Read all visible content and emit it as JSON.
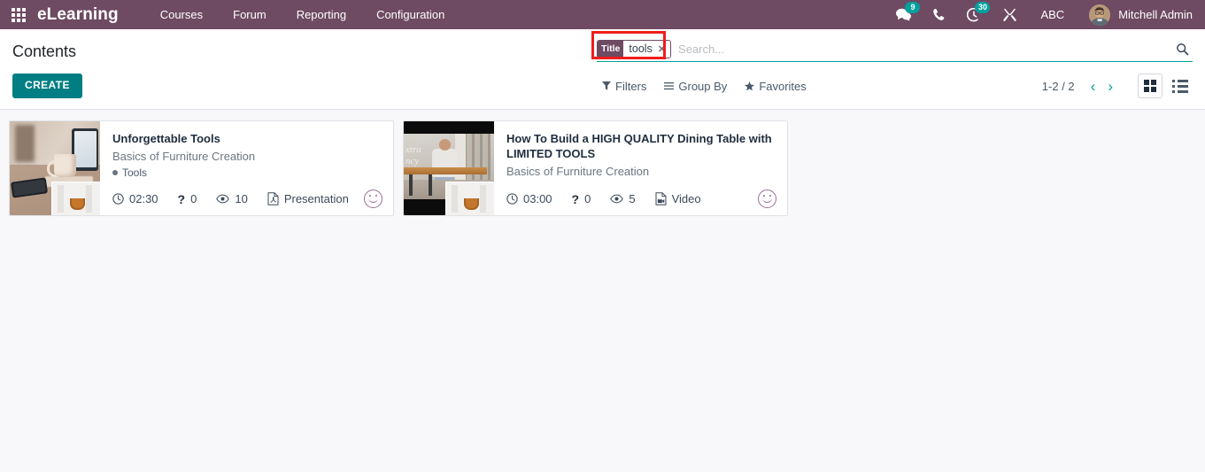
{
  "navbar": {
    "apps_icon": "grid-apps-icon",
    "brand": "eLearning",
    "menu_items": [
      {
        "label": "Courses"
      },
      {
        "label": "Forum"
      },
      {
        "label": "Reporting"
      },
      {
        "label": "Configuration"
      }
    ],
    "systray": {
      "messaging": {
        "icon": "messaging-icon",
        "count": "9"
      },
      "phone": {
        "icon": "phone-icon"
      },
      "activities": {
        "icon": "activity-clock-icon",
        "count": "30"
      },
      "debug": {
        "icon": "wrench-tools-icon"
      },
      "company": "ABC",
      "user_name": "Mitchell Admin",
      "avatar_icon": "user-avatar"
    },
    "background_color": "#6e4a63"
  },
  "control_panel": {
    "title": "Contents",
    "create_label": "CREATE",
    "create_color": "#017e84",
    "search": {
      "facet": {
        "label": "Title",
        "value": "tools",
        "remove_icon": "close-icon"
      },
      "placeholder": "Search...",
      "search_icon": "search-icon",
      "highlight_color": "#f01d1d"
    },
    "filter_menus": [
      {
        "label": "Filters",
        "icon": "funnel-icon"
      },
      {
        "label": "Group By",
        "icon": "hamburger-icon"
      },
      {
        "label": "Favorites",
        "icon": "star-icon"
      }
    ],
    "pager": {
      "value": "1-2 / 2",
      "previous_icon": "chevron-left-icon",
      "next_icon": "chevron-right-icon"
    },
    "view_switcher": [
      {
        "name": "kanban",
        "icon": "kanban-grid-icon",
        "active": true
      },
      {
        "name": "list",
        "icon": "list-icon",
        "active": false
      }
    ]
  },
  "kanban": {
    "cards": [
      {
        "title": "Unforgettable Tools",
        "subtitle": "Basics of Furniture Creation",
        "tag": "Tools",
        "duration": "02:30",
        "questions": "0",
        "views": "10",
        "content_type": "Presentation",
        "type_icon": "pdf-file-icon",
        "duration_icon": "clock-icon",
        "questions_icon": "question-mark-icon",
        "views_icon": "eye-icon",
        "status_icon": "smiley-circle-icon",
        "thumbnail": "desk-with-mug-photo"
      },
      {
        "title": "How To Build a HIGH QUALITY Dining Table with LIMITED TOOLS",
        "subtitle": "Basics of Furniture Creation",
        "tag": "",
        "duration": "03:00",
        "questions": "0",
        "views": "5",
        "content_type": "Video",
        "type_icon": "video-file-icon",
        "duration_icon": "clock-icon",
        "questions_icon": "question-mark-icon",
        "views_icon": "eye-icon",
        "status_icon": "smiley-circle-icon",
        "thumbnail": "dining-table-video-photo"
      }
    ]
  }
}
